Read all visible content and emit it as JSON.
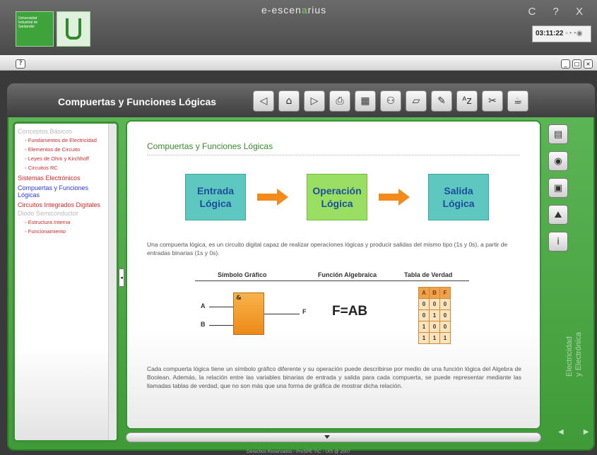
{
  "app": {
    "title_pre": "e-escen",
    "title_mid": "a",
    "title_post": "rius",
    "window_controls": "C ? X",
    "clock_time": "03:11:22",
    "university": "Universidad Industrial de Santander"
  },
  "toolbar": {
    "help": "?",
    "min_buttons": [
      "_",
      "□",
      "×"
    ]
  },
  "header": {
    "section_title": "Compuertas y Funciones Lógicas",
    "tools": [
      "back-icon",
      "home-icon",
      "next-icon",
      "print-icon",
      "calculator-icon",
      "network-icon",
      "eraser-icon",
      "notes-icon",
      "glossary-icon",
      "tools-icon",
      "cup-icon"
    ]
  },
  "sidebar": {
    "items": [
      {
        "type": "h",
        "label": "Conceptos Básicos"
      },
      {
        "type": "sub",
        "label": "Fundamentos de Electricidad"
      },
      {
        "type": "sub",
        "label": "Elementos de Circuito"
      },
      {
        "type": "sub",
        "label": "Leyes de Ohm y Kirchhoff"
      },
      {
        "type": "sub",
        "label": "Circuitos RC"
      },
      {
        "type": "main",
        "label": "Sistemas Electrónicos"
      },
      {
        "type": "active",
        "label": "Compuertas y Funciones Lógicas"
      },
      {
        "type": "main",
        "label": "Circuitos Integrados Digitales"
      },
      {
        "type": "h",
        "label": "Diodo Semiconductor"
      },
      {
        "type": "sub",
        "label": "Estructura Interna"
      },
      {
        "type": "sub",
        "label": "Funcionamiento"
      }
    ]
  },
  "content": {
    "title": "Compuertas y Funciones Lógicas",
    "box1": "Entrada Lógica",
    "box2": "Operación Lógica",
    "box3": "Salida Lógica",
    "para1": "Una compuerta lógica, es un circuito digital capaz de realizar operaciones lógicas y producir salidas del mismo tipo (1s y 0s), a partir de entradas binarias (1s y 0s).",
    "col_symbol": "Símbolo Gráfico",
    "col_function": "Función Algebraica",
    "col_table": "Tabla de Verdad",
    "gate_symbol": "&",
    "input_a": "A",
    "input_b": "B",
    "output_f": "F",
    "expression": "F=AB",
    "truth_table": {
      "header": [
        "A",
        "B",
        "F"
      ],
      "rows": [
        [
          "0",
          "0",
          "0"
        ],
        [
          "0",
          "1",
          "0"
        ],
        [
          "1",
          "0",
          "0"
        ],
        [
          "1",
          "1",
          "1"
        ]
      ]
    },
    "para2": "Cada compuerta lógica tiene un símbolo gráfico diferente y su operación puede describirse por medio de una función lógica del Algebra de Boolean. Además, la relación entre las variables binarias de entrada y salida para cada compuerta, se puede representar mediante las llamadas tablas de verdad, que no son más que una forma de gráfica de mostrar dicha relación."
  },
  "rightbar": {
    "buttons": [
      "document-icon",
      "audio-icon",
      "video-icon",
      "image-icon",
      "info-icon"
    ],
    "vertical_label_1": "Electricidad",
    "vertical_label_2": "y Electrónica"
  },
  "footer": "Derechos Reservados - ProSPE TIC - UIS @ 2007",
  "colors": {
    "frame_green": "#4fab47",
    "accent_teal": "#5ec8c0",
    "accent_lime": "#9adf63",
    "arrow_orange": "#f38b1c",
    "link_red": "#d32b2b",
    "link_blue": "#2a3ad8"
  }
}
